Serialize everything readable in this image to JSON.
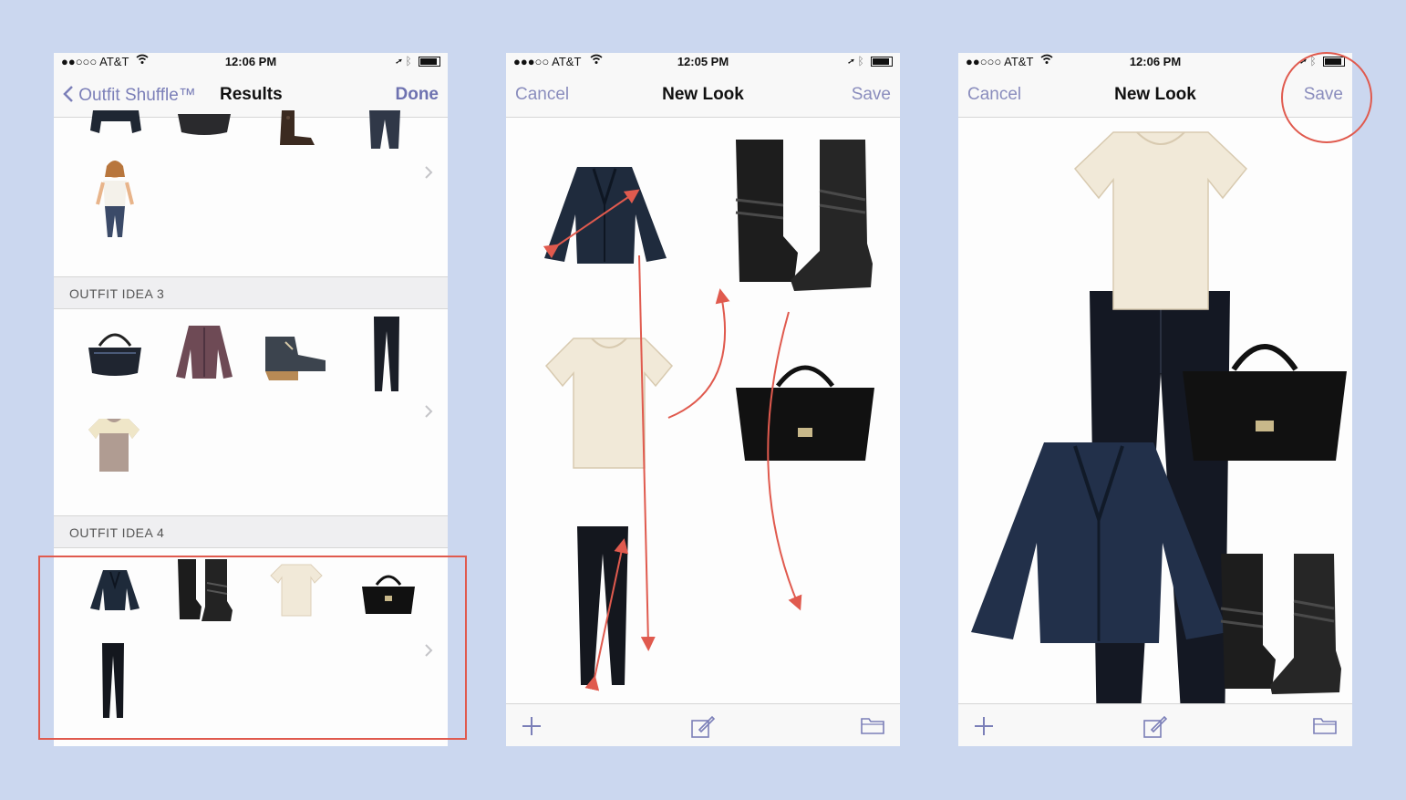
{
  "status_bars": [
    {
      "carrier": "●●○○○ AT&T",
      "time": "12:06 PM"
    },
    {
      "carrier": "●●●○○ AT&T",
      "time": "12:05 PM"
    },
    {
      "carrier": "●●○○○ AT&T",
      "time": "12:06 PM"
    }
  ],
  "screen1": {
    "back_label": "Outfit Shuffle™",
    "title": "Results",
    "done_label": "Done",
    "sections": [
      {
        "header": "OUTFIT IDEA 3"
      },
      {
        "header": "OUTFIT IDEA 4"
      }
    ]
  },
  "screen2": {
    "cancel_label": "Cancel",
    "title": "New Look",
    "save_label": "Save"
  },
  "screen3": {
    "cancel_label": "Cancel",
    "title": "New Look",
    "save_label": "Save"
  },
  "icons": [
    "chevron-left-icon",
    "wifi-icon",
    "location-arrow-icon",
    "bluetooth-icon",
    "battery-icon",
    "chevron-right-icon",
    "plus-icon",
    "compose-icon",
    "folder-icon"
  ],
  "colors": {
    "background": "#cbd7ef",
    "accent": "#7b7fb8",
    "annotation": "#e05a4e"
  }
}
